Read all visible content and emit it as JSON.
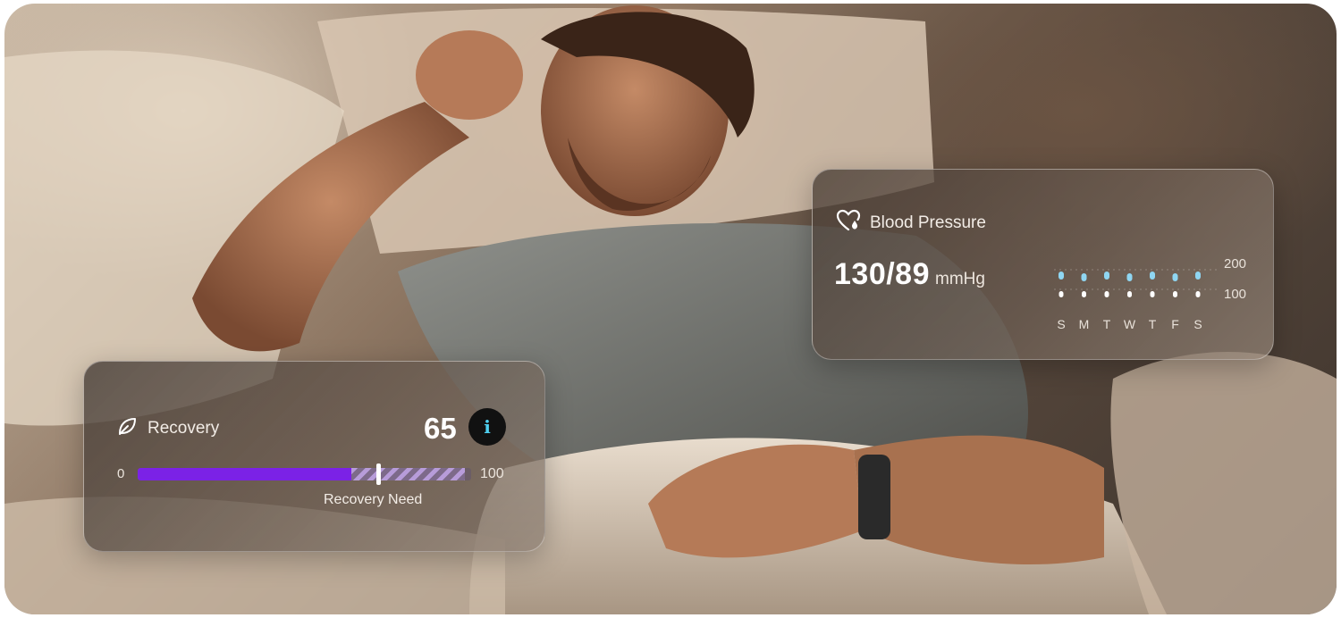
{
  "blood_pressure": {
    "icon": "heart-drop-icon",
    "title": "Blood Pressure",
    "value": "130/89",
    "unit": "mmHg",
    "chart": {
      "days": [
        "S",
        "M",
        "T",
        "W",
        "T",
        "F",
        "S"
      ],
      "y_ticks": [
        "200",
        "100"
      ],
      "colors": {
        "systolic": "#8fd6f2",
        "diastolic": "#ffffff"
      }
    }
  },
  "recovery": {
    "icon": "leaf-icon",
    "title": "Recovery",
    "score": "65",
    "info_icon": "info-icon",
    "info_glyph": "i",
    "scale_min": "0",
    "scale_max": "100",
    "fill_fraction": 0.64,
    "need_fraction": 0.72,
    "need_end_fraction": 1.0,
    "need_label": "Recovery Need",
    "colors": {
      "fill": "#7b22e6",
      "need": "#b79cd9"
    }
  }
}
